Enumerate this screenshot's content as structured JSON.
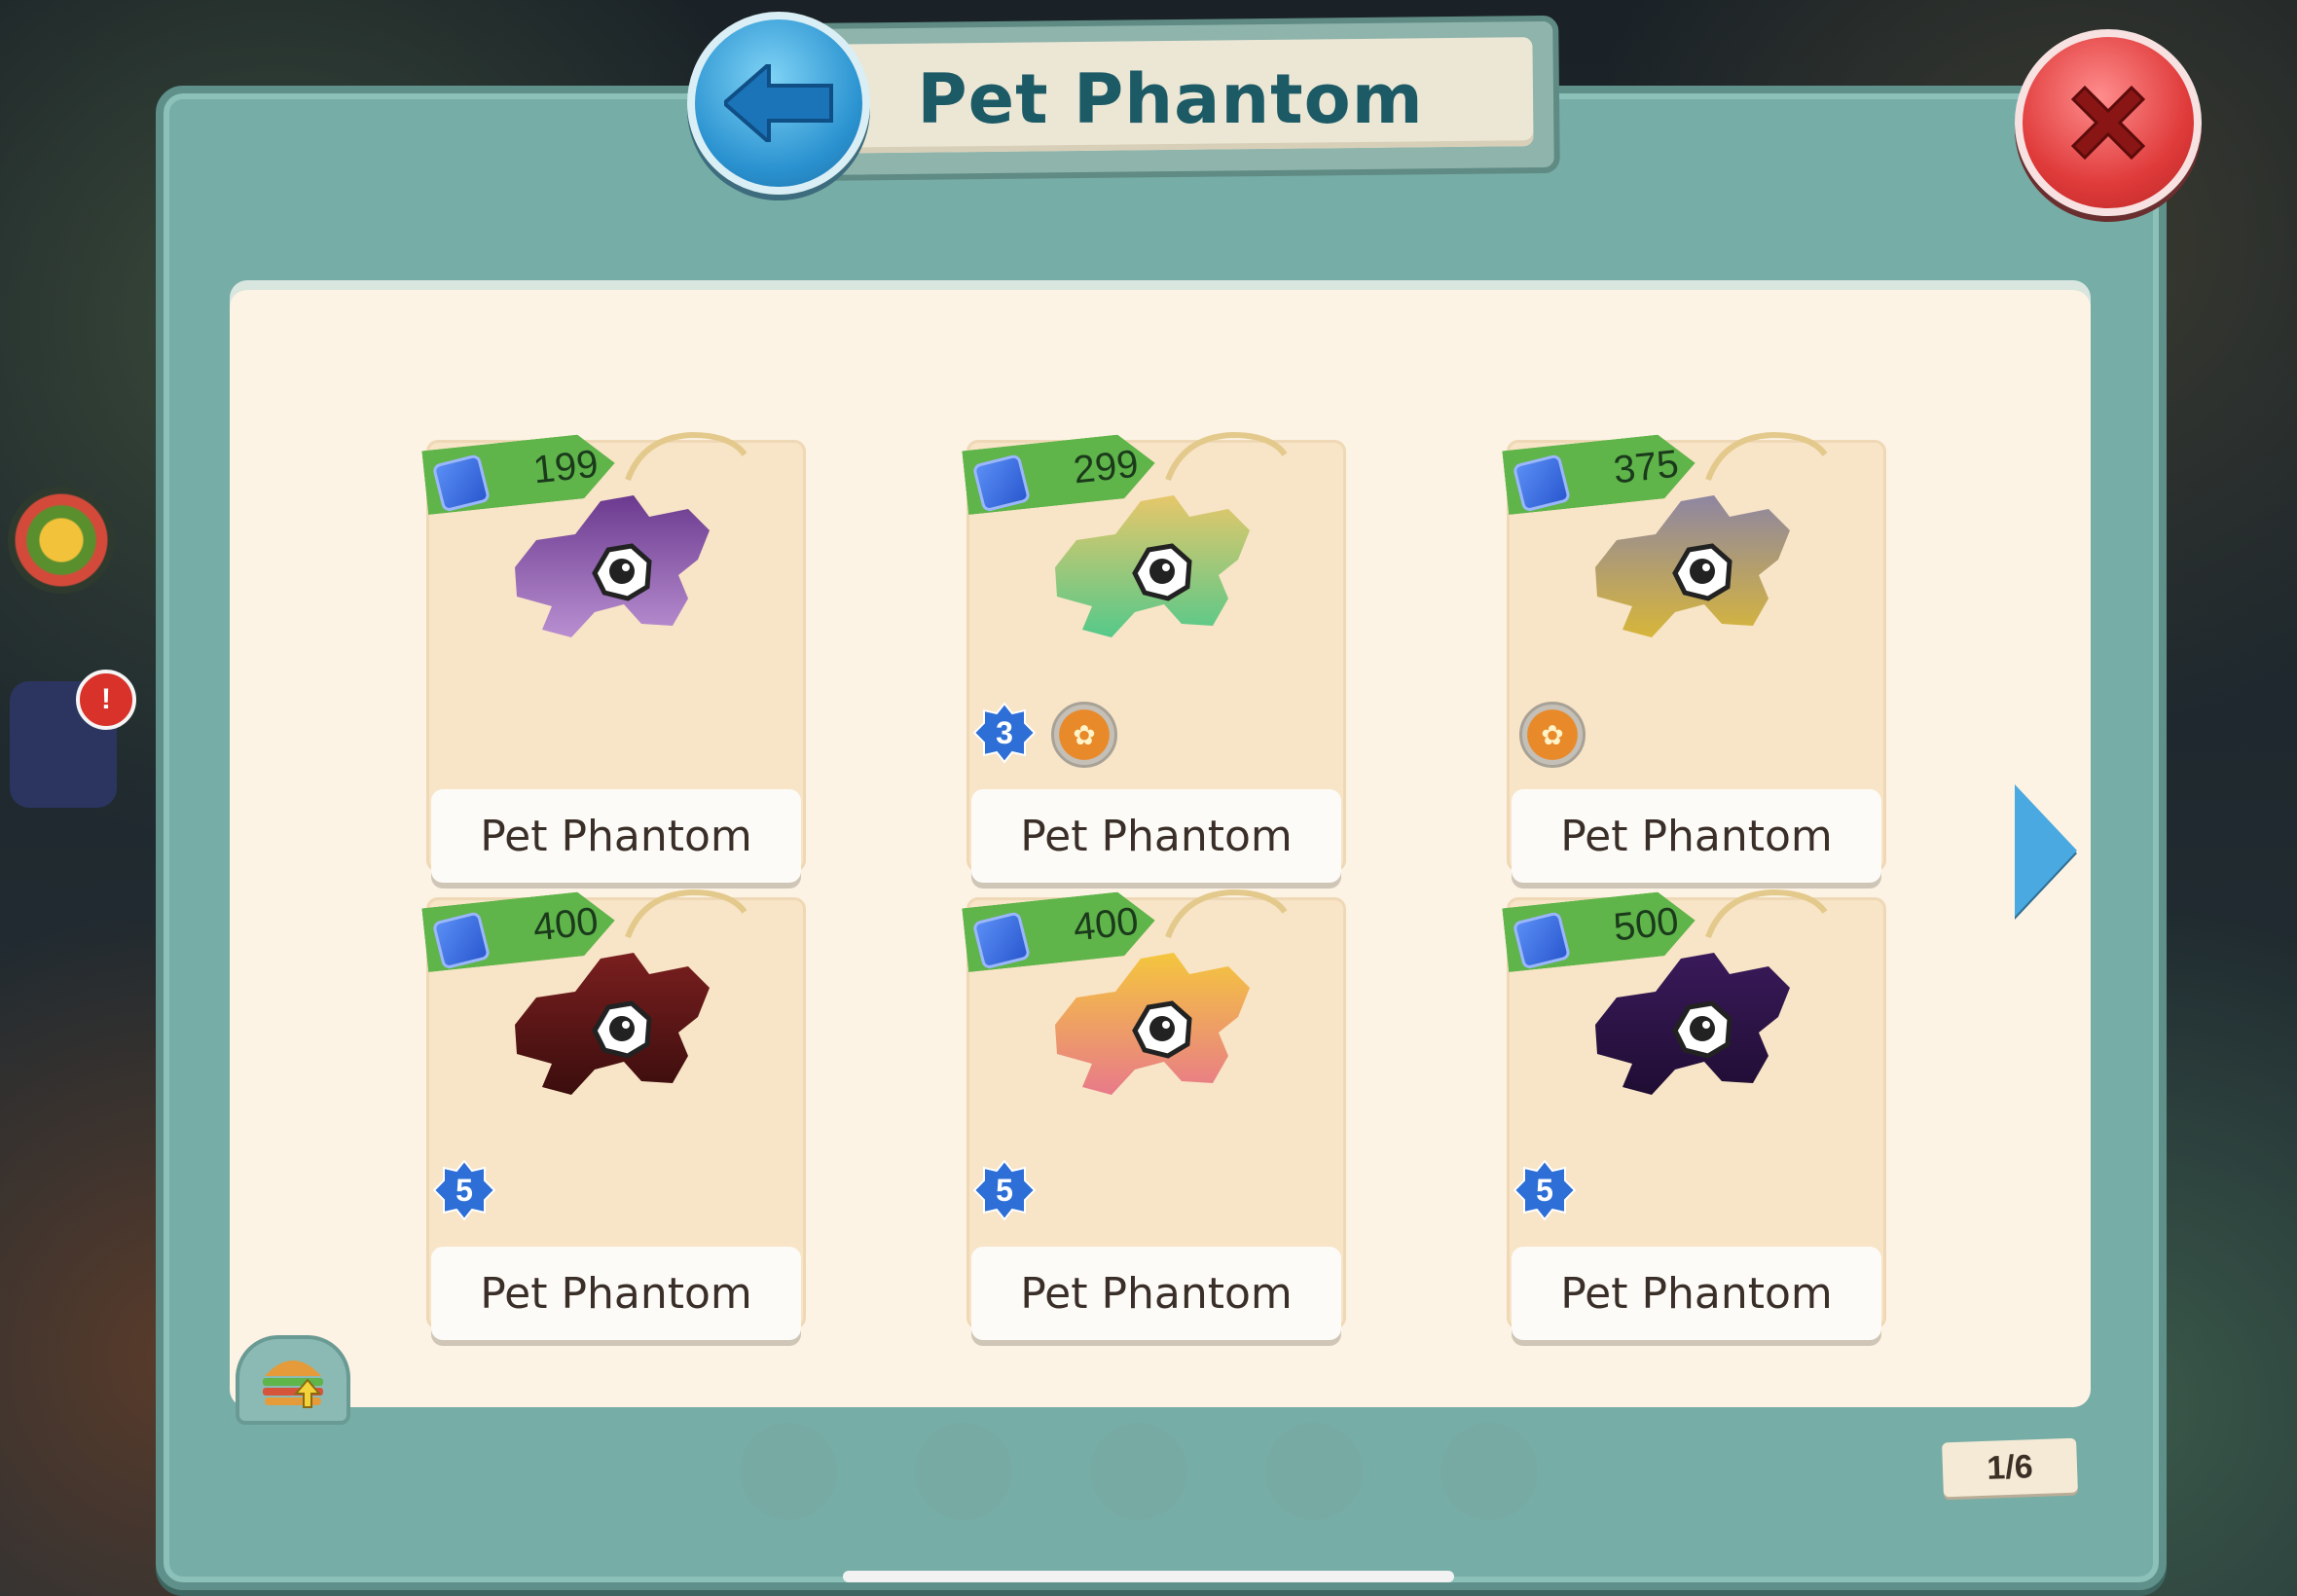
{
  "title": "Pet Phantom",
  "page_indicator": "1/6",
  "items": [
    {
      "name": "Pet Phantom",
      "price": "199",
      "body_color": "#6b3a8f",
      "accent": "#b98fd1",
      "level": null,
      "member": false
    },
    {
      "name": "Pet Phantom",
      "price": "299",
      "body_color": "#e7c76a",
      "accent": "#55c98a",
      "level": "3",
      "member": true
    },
    {
      "name": "Pet Phantom",
      "price": "375",
      "body_color": "#8e86a2",
      "accent": "#d7b63a",
      "level": null,
      "member": true
    },
    {
      "name": "Pet Phantom",
      "price": "400",
      "body_color": "#7a1f1f",
      "accent": "#3b0d0d",
      "level": "5",
      "member": false
    },
    {
      "name": "Pet Phantom",
      "price": "400",
      "body_color": "#f4c63d",
      "accent": "#e87a8a",
      "level": "5",
      "member": false
    },
    {
      "name": "Pet Phantom",
      "price": "500",
      "body_color": "#3a1a5a",
      "accent": "#1f0d33",
      "level": "5",
      "member": false
    }
  ],
  "background": {
    "alert_badge": "!"
  },
  "colors": {
    "frame": "#76ada6",
    "paper": "#fdf3e4",
    "price_tag": "#5fb44a",
    "title_text": "#1c5a66",
    "close": "#e03b3b",
    "back": "#2a92d0"
  }
}
